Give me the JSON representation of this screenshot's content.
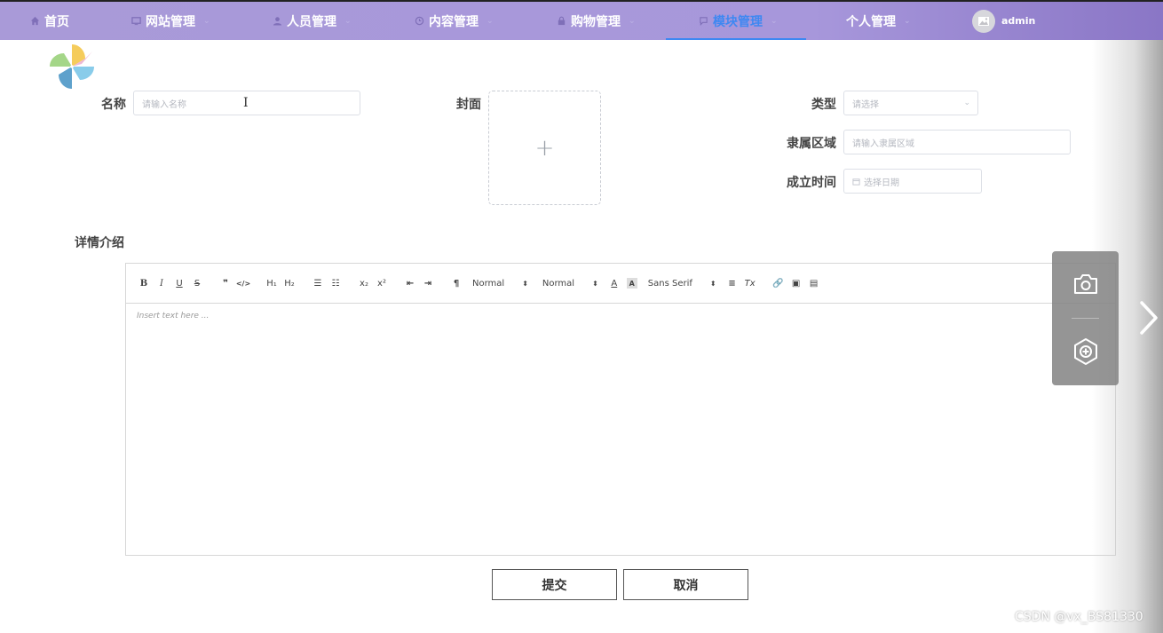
{
  "nav": {
    "items": [
      {
        "label": "首页",
        "icon": "home-icon",
        "active": false
      },
      {
        "label": "网站管理",
        "icon": "monitor-icon",
        "active": false
      },
      {
        "label": "人员管理",
        "icon": "user-icon",
        "active": false
      },
      {
        "label": "内容管理",
        "icon": "clock-icon",
        "active": false
      },
      {
        "label": "购物管理",
        "icon": "lock-icon",
        "active": false
      },
      {
        "label": "模块管理",
        "icon": "chat-icon",
        "active": true
      },
      {
        "label": "个人管理",
        "icon": "",
        "active": false
      }
    ],
    "user": "admin"
  },
  "form": {
    "name_label": "名称",
    "name_placeholder": "请输入名称",
    "cover_label": "封面",
    "cover_upload": "+",
    "type_label": "类型",
    "type_placeholder": "请选择",
    "area_label": "隶属区域",
    "area_placeholder": "请输入隶属区域",
    "date_label": "成立时间",
    "date_placeholder": "选择日期",
    "detail_label": "详情介绍"
  },
  "editor": {
    "header_select": "Normal",
    "size_select": "Normal",
    "font_select": "Sans Serif",
    "placeholder": "Insert text here ..."
  },
  "buttons": {
    "submit": "提交",
    "cancel": "取消"
  },
  "watermark": "CSDN @vx_BS81330",
  "colors": {
    "nav_bg": "#a99ad8",
    "active": "#3e88f2"
  }
}
